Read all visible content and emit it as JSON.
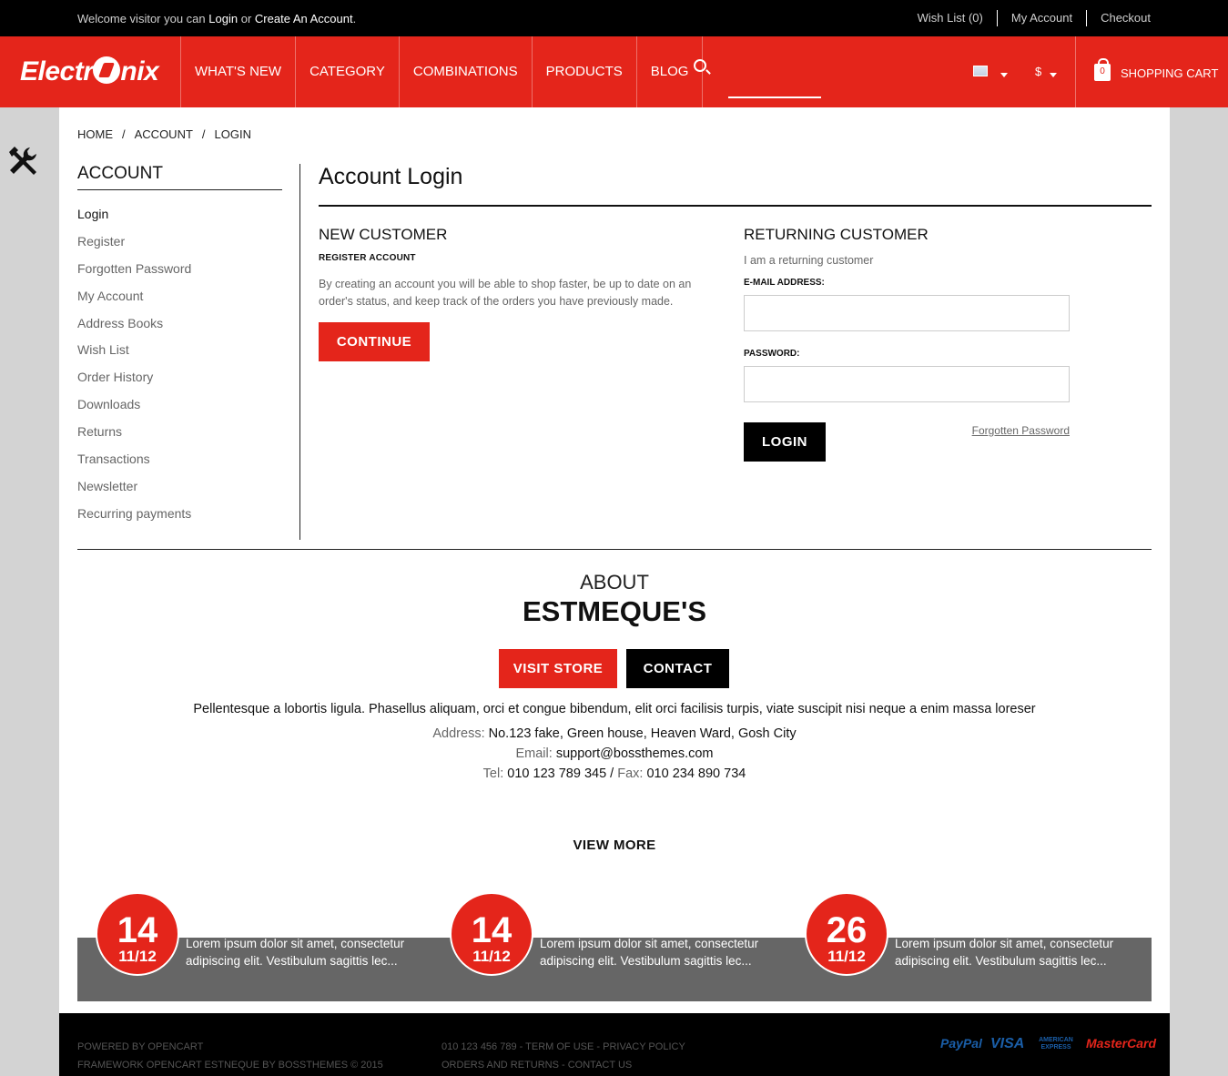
{
  "topbar": {
    "welcome_prefix": "Welcome visitor you can",
    "login_link": "Login",
    "or_text": "or",
    "create_link": "Create An Account",
    "period": ".",
    "links": [
      "Wish List (0)",
      "My Account",
      "Checkout"
    ]
  },
  "header": {
    "logo_left": "Electr",
    "logo_right": "nix",
    "nav": [
      "WHAT'S NEW",
      "CATEGORY",
      "COMBINATIONS",
      "PRODUCTS",
      "BLOG"
    ],
    "search_placeholder": "",
    "currency": "$",
    "cart_count": "0",
    "cart_label": "SHOPPING CART"
  },
  "breadcrumb": [
    "HOME",
    "ACCOUNT",
    "LOGIN"
  ],
  "breadcrumb_sep": "/",
  "sidebar": {
    "title": "ACCOUNT",
    "items": [
      "Login",
      "Register",
      "Forgotten Password",
      "My Account",
      "Address Books",
      "Wish List",
      "Order History",
      "Downloads",
      "Returns",
      "Transactions",
      "Newsletter",
      "Recurring payments"
    ]
  },
  "content": {
    "title": "Account Login",
    "new_customer": {
      "heading": "NEW CUSTOMER",
      "sub": "REGISTER ACCOUNT",
      "text": "By creating an account you will be able to shop faster, be up to date on an order's status, and keep track of the orders you have previously made.",
      "button": "CONTINUE"
    },
    "returning_customer": {
      "heading": "RETURNING CUSTOMER",
      "sub": "I am a returning customer",
      "email_label": "E-MAIL ADDRESS:",
      "email_value": "",
      "password_label": "PASSWORD:",
      "password_value": "",
      "login_button": "LOGIN",
      "forgot_link": "Forgotten Password"
    }
  },
  "about": {
    "pre": "ABOUT",
    "title": "ESTMEQUE'S",
    "visit_button": "VISIT STORE",
    "contact_button": "CONTACT",
    "text": "Pellentesque a lobortis ligula. Phasellus aliquam, orci et congue bibendum, elit orci facilisis turpis, viate suscipit nisi neque a enim massa loreser",
    "address_label": "Address:",
    "address": "No.123 fake, Green house, Heaven Ward, Gosh City",
    "email_label": "Email:",
    "email": "support@bossthemes.com",
    "tel_label": "Tel:",
    "tel": "010 123 789 345",
    "tel_sep": "/",
    "fax_label": "Fax:",
    "fax": "010 234 890 734",
    "view_more": "VIEW MORE"
  },
  "news": [
    {
      "day": "14",
      "month": "11/12",
      "text": "Lorem ipsum dolor sit amet, consectetur adipiscing elit. Vestibulum sagittis lec..."
    },
    {
      "day": "14",
      "month": "11/12",
      "text": "Lorem ipsum dolor sit amet, consectetur adipiscing elit. Vestibulum sagittis lec..."
    },
    {
      "day": "26",
      "month": "11/12",
      "text": "Lorem ipsum dolor sit amet, consectetur adipiscing elit. Vestibulum sagittis lec..."
    }
  ],
  "footer": {
    "line1": "POWERED BY OPENCART",
    "line2": "FRAMEWORK OPENCART ESTNEQUE BY BOSSTHEMES © 2015",
    "line3": "010 123 456 789 - TERM OF USE - PRIVACY POLICY",
    "line4": "ORDERS AND RETURNS - CONTACT US",
    "payments": [
      "PayPal",
      "VISA",
      "AMERICAN EXPRESS",
      "MasterCard"
    ]
  },
  "colors": {
    "brand_red": "#e4251b",
    "black": "#000000",
    "news_gray": "#666666"
  }
}
